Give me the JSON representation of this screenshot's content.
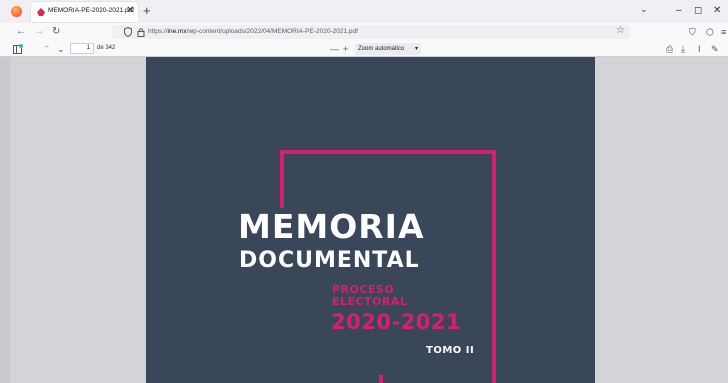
{
  "browser": {
    "tab_title": "MEMORIA-PE-2020-2021.pdf",
    "tab_close": "✕",
    "new_tab": "+",
    "tab_list": "⌄",
    "window_controls": {
      "minimize": "–",
      "maximize": "◻",
      "close": "✕"
    }
  },
  "nav": {
    "back": "←",
    "forward": "→",
    "reload": "↻",
    "url_prefix": "https://",
    "url_host": "ine.mx",
    "url_path": "/wp-content/uploads/2022/04/MEMORIA-PE-2020-2021.pdf",
    "bookmark": "☆",
    "pocket": "⛉",
    "extensions": "⬡",
    "menu": "≡"
  },
  "pdf_toolbar": {
    "prev": "⌃",
    "next": "⌄",
    "page_number": "1",
    "page_total": "de 342",
    "zoom_out": "—",
    "zoom_in": "+",
    "zoom_value": "Zoom automático",
    "print": "⎙",
    "save": "⤓",
    "text_tool": "I",
    "draw_tool": "✎"
  },
  "document": {
    "title_line1": "MEMORIA",
    "title_line2": "DOCUMENTAL",
    "subtitle_line1": "PROCESO",
    "subtitle_line2": "ELECTORAL",
    "years": "2020-2021",
    "volume": "TOMO II"
  },
  "colors": {
    "page_background": "#3a465a",
    "accent": "#d41f74"
  }
}
